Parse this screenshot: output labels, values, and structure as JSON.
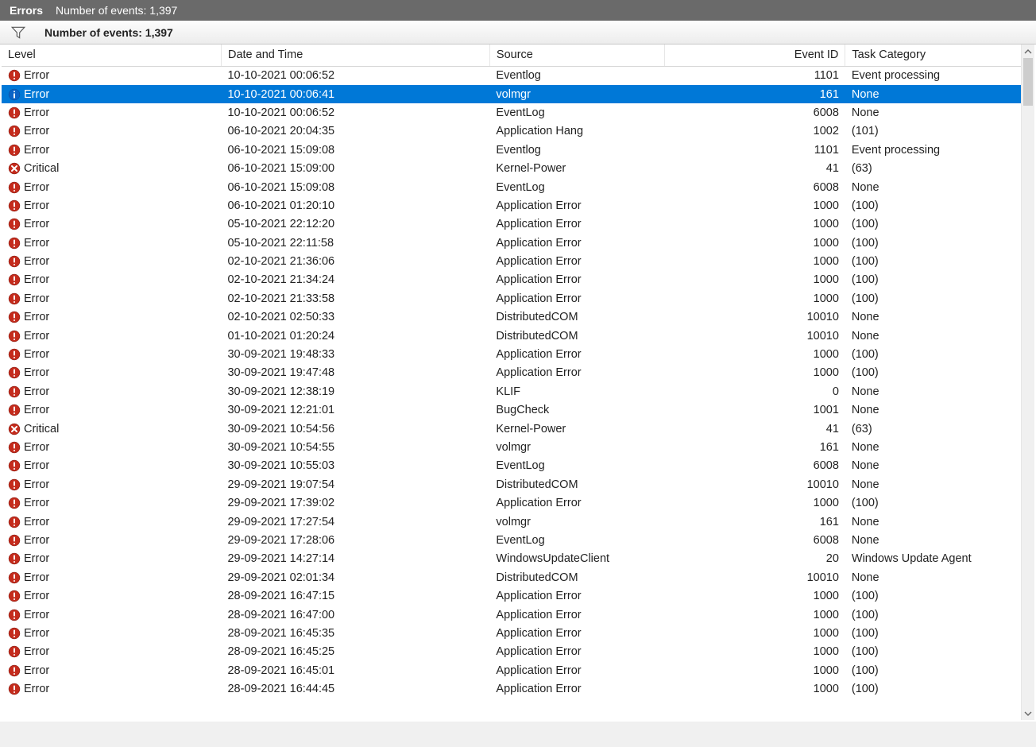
{
  "titlebar": {
    "title": "Errors",
    "count_label": "Number of events: 1,397"
  },
  "filterbar": {
    "label": "Number of events: 1,397"
  },
  "columns": {
    "level": "Level",
    "datetime": "Date and Time",
    "source": "Source",
    "eventid": "Event ID",
    "task": "Task Category"
  },
  "rows": [
    {
      "level": "Error",
      "icon": "error",
      "date": "10-10-2021 00:06:52",
      "source": "Eventlog",
      "id": "1101",
      "task": "Event processing",
      "sel": false
    },
    {
      "level": "Error",
      "icon": "info",
      "date": "10-10-2021 00:06:41",
      "source": "volmgr",
      "id": "161",
      "task": "None",
      "sel": true
    },
    {
      "level": "Error",
      "icon": "error",
      "date": "10-10-2021 00:06:52",
      "source": "EventLog",
      "id": "6008",
      "task": "None",
      "sel": false
    },
    {
      "level": "Error",
      "icon": "error",
      "date": "06-10-2021 20:04:35",
      "source": "Application Hang",
      "id": "1002",
      "task": "(101)",
      "sel": false
    },
    {
      "level": "Error",
      "icon": "error",
      "date": "06-10-2021 15:09:08",
      "source": "Eventlog",
      "id": "1101",
      "task": "Event processing",
      "sel": false
    },
    {
      "level": "Critical",
      "icon": "critical",
      "date": "06-10-2021 15:09:00",
      "source": "Kernel-Power",
      "id": "41",
      "task": "(63)",
      "sel": false
    },
    {
      "level": "Error",
      "icon": "error",
      "date": "06-10-2021 15:09:08",
      "source": "EventLog",
      "id": "6008",
      "task": "None",
      "sel": false
    },
    {
      "level": "Error",
      "icon": "error",
      "date": "06-10-2021 01:20:10",
      "source": "Application Error",
      "id": "1000",
      "task": "(100)",
      "sel": false
    },
    {
      "level": "Error",
      "icon": "error",
      "date": "05-10-2021 22:12:20",
      "source": "Application Error",
      "id": "1000",
      "task": "(100)",
      "sel": false
    },
    {
      "level": "Error",
      "icon": "error",
      "date": "05-10-2021 22:11:58",
      "source": "Application Error",
      "id": "1000",
      "task": "(100)",
      "sel": false
    },
    {
      "level": "Error",
      "icon": "error",
      "date": "02-10-2021 21:36:06",
      "source": "Application Error",
      "id": "1000",
      "task": "(100)",
      "sel": false
    },
    {
      "level": "Error",
      "icon": "error",
      "date": "02-10-2021 21:34:24",
      "source": "Application Error",
      "id": "1000",
      "task": "(100)",
      "sel": false
    },
    {
      "level": "Error",
      "icon": "error",
      "date": "02-10-2021 21:33:58",
      "source": "Application Error",
      "id": "1000",
      "task": "(100)",
      "sel": false
    },
    {
      "level": "Error",
      "icon": "error",
      "date": "02-10-2021 02:50:33",
      "source": "DistributedCOM",
      "id": "10010",
      "task": "None",
      "sel": false
    },
    {
      "level": "Error",
      "icon": "error",
      "date": "01-10-2021 01:20:24",
      "source": "DistributedCOM",
      "id": "10010",
      "task": "None",
      "sel": false
    },
    {
      "level": "Error",
      "icon": "error",
      "date": "30-09-2021 19:48:33",
      "source": "Application Error",
      "id": "1000",
      "task": "(100)",
      "sel": false
    },
    {
      "level": "Error",
      "icon": "error",
      "date": "30-09-2021 19:47:48",
      "source": "Application Error",
      "id": "1000",
      "task": "(100)",
      "sel": false
    },
    {
      "level": "Error",
      "icon": "error",
      "date": "30-09-2021 12:38:19",
      "source": "KLIF",
      "id": "0",
      "task": "None",
      "sel": false
    },
    {
      "level": "Error",
      "icon": "error",
      "date": "30-09-2021 12:21:01",
      "source": "BugCheck",
      "id": "1001",
      "task": "None",
      "sel": false
    },
    {
      "level": "Critical",
      "icon": "critical",
      "date": "30-09-2021 10:54:56",
      "source": "Kernel-Power",
      "id": "41",
      "task": "(63)",
      "sel": false
    },
    {
      "level": "Error",
      "icon": "error",
      "date": "30-09-2021 10:54:55",
      "source": "volmgr",
      "id": "161",
      "task": "None",
      "sel": false
    },
    {
      "level": "Error",
      "icon": "error",
      "date": "30-09-2021 10:55:03",
      "source": "EventLog",
      "id": "6008",
      "task": "None",
      "sel": false
    },
    {
      "level": "Error",
      "icon": "error",
      "date": "29-09-2021 19:07:54",
      "source": "DistributedCOM",
      "id": "10010",
      "task": "None",
      "sel": false
    },
    {
      "level": "Error",
      "icon": "error",
      "date": "29-09-2021 17:39:02",
      "source": "Application Error",
      "id": "1000",
      "task": "(100)",
      "sel": false
    },
    {
      "level": "Error",
      "icon": "error",
      "date": "29-09-2021 17:27:54",
      "source": "volmgr",
      "id": "161",
      "task": "None",
      "sel": false
    },
    {
      "level": "Error",
      "icon": "error",
      "date": "29-09-2021 17:28:06",
      "source": "EventLog",
      "id": "6008",
      "task": "None",
      "sel": false
    },
    {
      "level": "Error",
      "icon": "error",
      "date": "29-09-2021 14:27:14",
      "source": "WindowsUpdateClient",
      "id": "20",
      "task": "Windows Update Agent",
      "sel": false
    },
    {
      "level": "Error",
      "icon": "error",
      "date": "29-09-2021 02:01:34",
      "source": "DistributedCOM",
      "id": "10010",
      "task": "None",
      "sel": false
    },
    {
      "level": "Error",
      "icon": "error",
      "date": "28-09-2021 16:47:15",
      "source": "Application Error",
      "id": "1000",
      "task": "(100)",
      "sel": false
    },
    {
      "level": "Error",
      "icon": "error",
      "date": "28-09-2021 16:47:00",
      "source": "Application Error",
      "id": "1000",
      "task": "(100)",
      "sel": false
    },
    {
      "level": "Error",
      "icon": "error",
      "date": "28-09-2021 16:45:35",
      "source": "Application Error",
      "id": "1000",
      "task": "(100)",
      "sel": false
    },
    {
      "level": "Error",
      "icon": "error",
      "date": "28-09-2021 16:45:25",
      "source": "Application Error",
      "id": "1000",
      "task": "(100)",
      "sel": false
    },
    {
      "level": "Error",
      "icon": "error",
      "date": "28-09-2021 16:45:01",
      "source": "Application Error",
      "id": "1000",
      "task": "(100)",
      "sel": false
    },
    {
      "level": "Error",
      "icon": "error",
      "date": "28-09-2021 16:44:45",
      "source": "Application Error",
      "id": "1000",
      "task": "(100)",
      "sel": false
    }
  ],
  "icons": {
    "error": "error-icon",
    "critical": "critical-icon",
    "info": "info-icon"
  }
}
